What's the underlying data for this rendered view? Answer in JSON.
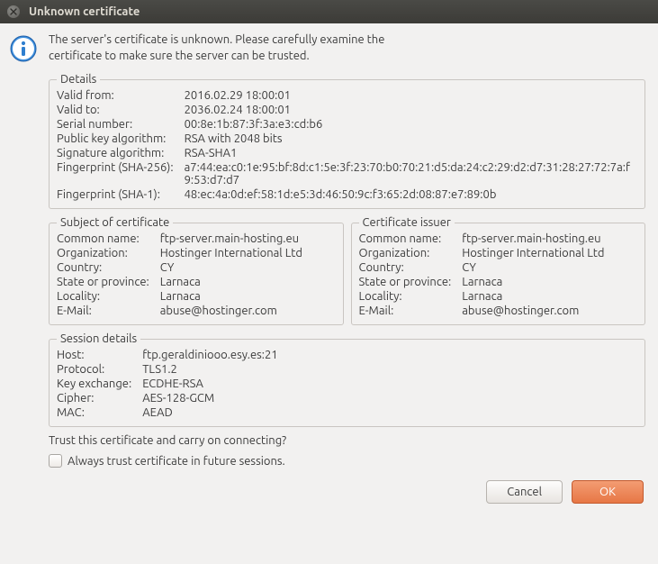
{
  "title": "Unknown certificate",
  "message": "The server's certificate is unknown. Please carefully examine the certificate to make sure the server can be trusted.",
  "details": {
    "legend": "Details",
    "rows": {
      "valid_from_l": "Valid from:",
      "valid_from_v": "2016.02.29 18:00:01",
      "valid_to_l": "Valid to:",
      "valid_to_v": "2036.02.24 18:00:01",
      "serial_l": "Serial number:",
      "serial_v": "00:8e:1b:87:3f:3a:e3:cd:b6",
      "pubkey_l": "Public key algorithm:",
      "pubkey_v": "RSA with 2048 bits",
      "sigalg_l": "Signature algorithm:",
      "sigalg_v": "RSA-SHA1",
      "fp256_l": "Fingerprint (SHA-256):",
      "fp256_v": "a7:44:ea:c0:1e:95:bf:8d:c1:5e:3f:23:70:b0:70:21:d5:da:24:c2:29:d2:d7:31:28:27:72:7a:f9:53:d7:d7",
      "fp1_l": "Fingerprint (SHA-1):",
      "fp1_v": "48:ec:4a:0d:ef:58:1d:e5:3d:46:50:9c:f3:65:2d:08:87:e7:89:0b"
    }
  },
  "subject": {
    "legend": "Subject of certificate",
    "cn_l": "Common name:",
    "cn_v": "ftp-server.main-hosting.eu",
    "org_l": "Organization:",
    "org_v": "Hostinger International Ltd",
    "country_l": "Country:",
    "country_v": "CY",
    "state_l": "State or province:",
    "state_v": "Larnaca",
    "loc_l": "Locality:",
    "loc_v": "Larnaca",
    "email_l": "E-Mail:",
    "email_v": "abuse@hostinger.com"
  },
  "issuer": {
    "legend": "Certificate issuer",
    "cn_l": "Common name:",
    "cn_v": "ftp-server.main-hosting.eu",
    "org_l": "Organization:",
    "org_v": "Hostinger International Ltd",
    "country_l": "Country:",
    "country_v": "CY",
    "state_l": "State or province:",
    "state_v": "Larnaca",
    "loc_l": "Locality:",
    "loc_v": "Larnaca",
    "email_l": "E-Mail:",
    "email_v": "abuse@hostinger.com"
  },
  "session": {
    "legend": "Session details",
    "host_l": "Host:",
    "host_v": "ftp.geraldiniooo.esy.es:21",
    "proto_l": "Protocol:",
    "proto_v": "TLS1.2",
    "kx_l": "Key exchange:",
    "kx_v": "ECDHE-RSA",
    "cipher_l": "Cipher:",
    "cipher_v": "AES-128-GCM",
    "mac_l": "MAC:",
    "mac_v": "AEAD"
  },
  "prompt": "Trust this certificate and carry on connecting?",
  "checkbox_label": "Always trust certificate in future sessions.",
  "buttons": {
    "cancel": "Cancel",
    "ok": "OK"
  }
}
